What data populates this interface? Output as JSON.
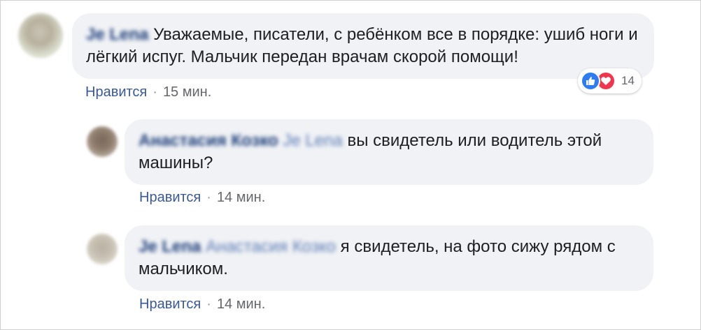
{
  "comments": [
    {
      "author": "Je Lena",
      "mention": "",
      "text": "Уважаемые, писатели, с ребёнком все в порядке: ушиб ноги и лёгкий испуг. Мальчик передан врачам скорой помощи!",
      "like_label": "Нравится",
      "separator": "·",
      "time": "15 мин.",
      "reactions": {
        "icons": [
          "like-icon",
          "love-icon"
        ],
        "like_color": "#2d7df0",
        "love_color": "#f0364f",
        "count": "14"
      }
    },
    {
      "author": "Анастасия Козко",
      "mention": "Je Lena",
      "text": "вы свидетель или водитель этой машины?",
      "like_label": "Нравится",
      "separator": "·",
      "time": "14 мин."
    },
    {
      "author": "Je Lena",
      "mention": "Анастасия Козко",
      "text": "я свидетель, на фото сижу рядом с мальчиком.",
      "like_label": "Нравится",
      "separator": "·",
      "time": "14 мин."
    }
  ],
  "colors": {
    "bubble_bg": "#f0f2f5",
    "link": "#385898",
    "meta": "#65676b"
  }
}
